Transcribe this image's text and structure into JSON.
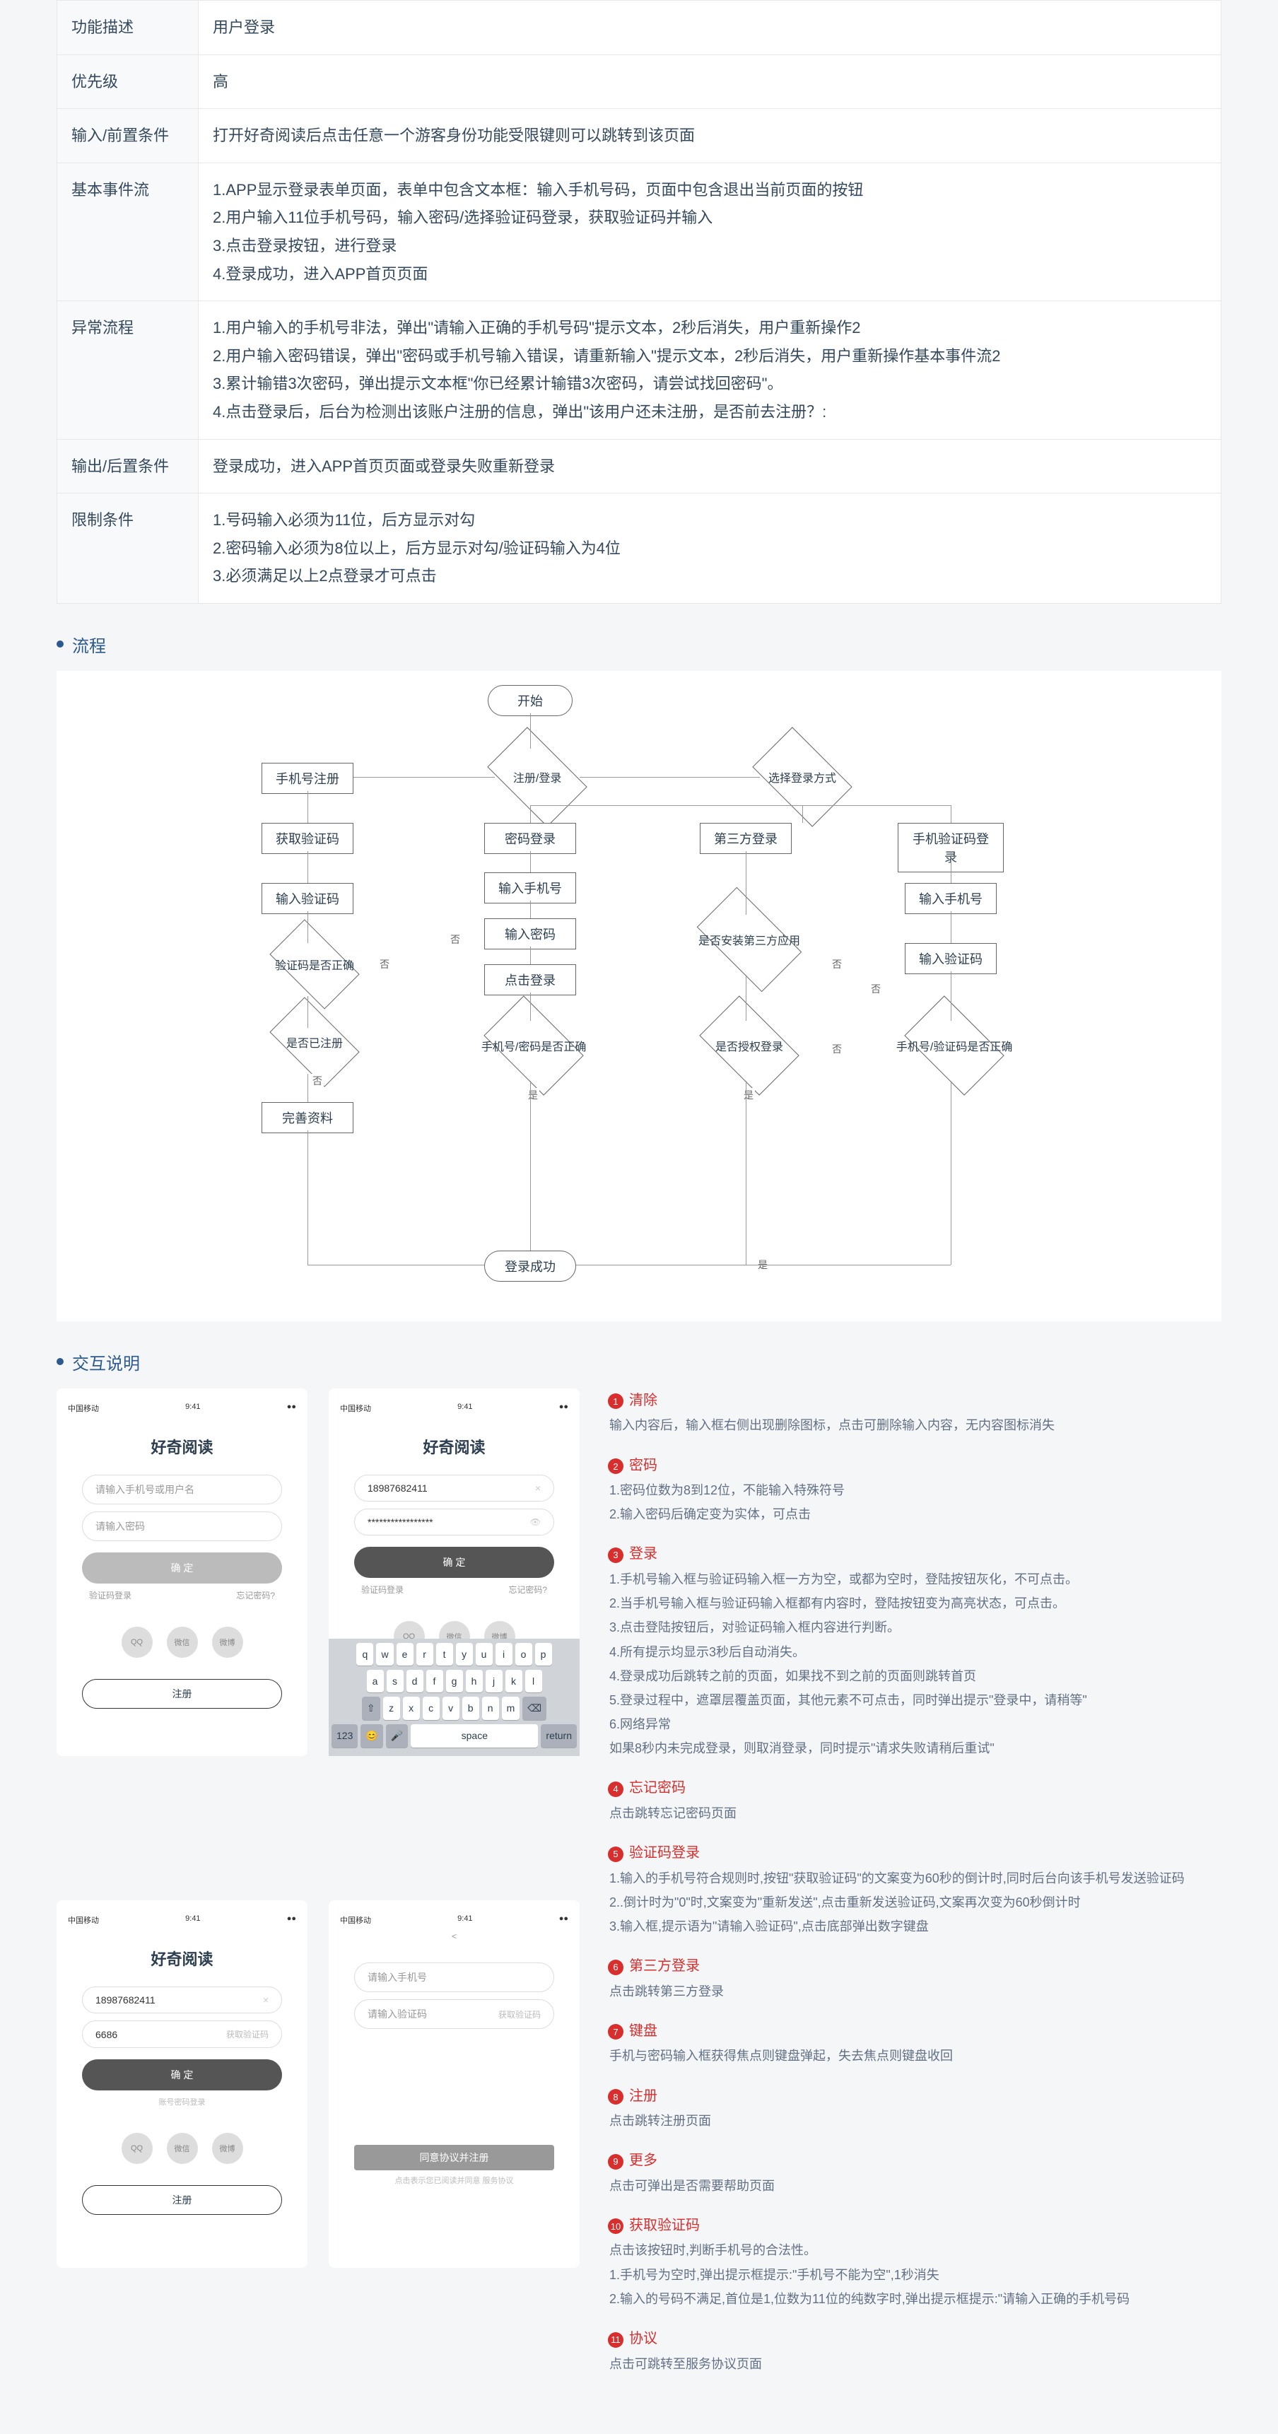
{
  "table": {
    "rows": [
      {
        "label": "功能描述",
        "value": "用户登录"
      },
      {
        "label": "优先级",
        "value": "高"
      },
      {
        "label": "输入/前置条件",
        "value": "打开好奇阅读后点击任意一个游客身份功能受限键则可以跳转到该页面"
      },
      {
        "label": "基本事件流",
        "value": "1.APP显示登录表单页面，表单中包含文本框：输入手机号码，页面中包含退出当前页面的按钮\n2.用户输入11位手机号码，输入密码/选择验证码登录，获取验证码并输入\n3.点击登录按钮，进行登录\n4.登录成功，进入APP首页页面"
      },
      {
        "label": "异常流程",
        "value": "1.用户输入的手机号非法，弹出\"请输入正确的手机号码\"提示文本，2秒后消失，用户重新操作2\n2.用户输入密码错误，弹出\"密码或手机号输入错误，请重新输入\"提示文本，2秒后消失，用户重新操作基本事件流2\n3.累计输错3次密码，弹出提示文本框\"你已经累计输错3次密码，请尝试找回密码\"。\n4.点击登录后，后台为检测出该账户注册的信息，弹出\"该用户还未注册，是否前去注册？:"
      },
      {
        "label": "输出/后置条件",
        "value": "登录成功，进入APP首页页面或登录失败重新登录"
      },
      {
        "label": "限制条件",
        "value": "1.号码输入必须为11位，后方显示对勾\n2.密码输入必须为8位以上，后方显示对勾/验证码输入为4位\n3.必须满足以上2点登录才可点击"
      }
    ]
  },
  "sections": {
    "flow": "流程",
    "interaction": "交互说明"
  },
  "flow": {
    "start": "开始",
    "reg_login": "注册/登录",
    "phone_reg": "手机号注册",
    "get_code": "获取验证码",
    "input_code": "输入验证码",
    "code_ok": "验证码是否正确",
    "registered": "是否已注册",
    "fill_info": "完善资料",
    "choose_method": "选择登录方式",
    "third_login": "第三方登录",
    "third_installed": "是否安装第三方应用",
    "third_auth": "是否授权登录",
    "pwd_login": "密码登录",
    "input_phone": "输入手机号",
    "input_pwd": "输入密码",
    "click_login": "点击登录",
    "pwd_ok": "手机号/密码是否正确",
    "sms_login": "手机验证码登录",
    "input_phone2": "输入手机号",
    "input_code2": "输入验证码",
    "sms_ok": "手机号/验证码是否正确",
    "success": "登录成功",
    "yes": "是",
    "no": "否"
  },
  "mock": {
    "app_title": "好奇阅读",
    "carrier": "中国移动",
    "phone_value": "18987682411",
    "pwd_value": "*****************",
    "code_value": "6686",
    "placeholder_phone": "请输入手机号",
    "placeholder_verify": "请输入验证码",
    "btn_ok": "确 定",
    "link_sms": "验证码登录",
    "link_forgot": "忘记密码?",
    "get_code_link": "获取验证码",
    "btn_register": "注册",
    "agree_register": "同意协议并注册",
    "agree_hint": "点击表示您已阅读并同意 服务协议",
    "social": [
      "QQ",
      "微信",
      "微博"
    ],
    "status_center": "9:41",
    "ph_account": "请输入手机号或用户名",
    "ph_password": "请输入密码"
  },
  "notes": [
    {
      "n": 1,
      "title": "清除",
      "body": "输入内容后，输入框右侧出现删除图标，点击可删除输入内容，无内容图标消失"
    },
    {
      "n": 2,
      "title": "密码",
      "body": "1.密码位数为8到12位，不能输入特殊符号\n2.输入密码后确定变为实体，可点击"
    },
    {
      "n": 3,
      "title": "登录",
      "body": "1.手机号输入框与验证码输入框一方为空，或都为空时，登陆按钮灰化，不可点击。\n2.当手机号输入框与验证码输入框都有内容时，登陆按钮变为高亮状态，可点击。\n3.点击登陆按钮后，对验证码输入框内容进行判断。\n4.所有提示均显示3秒后自动消失。\n4.登录成功后跳转之前的页面，如果找不到之前的页面则跳转首页\n5.登录过程中，遮罩层覆盖页面，其他元素不可点击，同时弹出提示\"登录中，请稍等\"\n6.网络异常\n如果8秒内未完成登录，则取消登录，同时提示\"请求失败请稍后重试\""
    },
    {
      "n": 4,
      "title": "忘记密码",
      "body": "点击跳转忘记密码页面"
    },
    {
      "n": 5,
      "title": "验证码登录",
      "body": "1.输入的手机号符合规则时,按钮\"获取验证码\"的文案变为60秒的倒计时,同时后台向该手机号发送验证码\n2..倒计时为\"0\"时,文案变为\"重新发送\",点击重新发送验证码,文案再次变为60秒倒计时\n3.输入框,提示语为\"请输入验证码\",点击底部弹出数字键盘"
    },
    {
      "n": 6,
      "title": "第三方登录",
      "body": "点击跳转第三方登录"
    },
    {
      "n": 7,
      "title": "键盘",
      "body": "手机与密码输入框获得焦点则键盘弹起，失去焦点则键盘收回"
    },
    {
      "n": 8,
      "title": "注册",
      "body": "点击跳转注册页面"
    },
    {
      "n": 9,
      "title": "更多",
      "body": "点击可弹出是否需要帮助页面"
    },
    {
      "n": 10,
      "title": "获取验证码",
      "body": "点击该按钮时,判断手机号的合法性。\n1.手机号为空时,弹出提示框提示:\"手机号不能为空\",1秒消失\n2.输入的号码不满足,首位是1,位数为11位的纯数字时,弹出提示框提示:\"请输入正确的手机号码"
    },
    {
      "n": 11,
      "title": "协议",
      "body": "点击可跳转至服务协议页面"
    }
  ]
}
